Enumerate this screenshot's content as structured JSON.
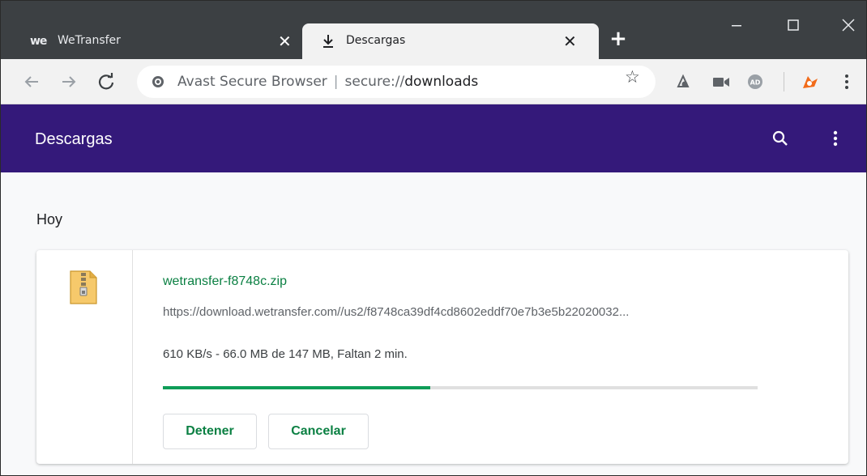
{
  "browser": {
    "tabs": [
      {
        "logo": "we",
        "label": "WeTransfer",
        "active": false
      },
      {
        "label": "Descargas",
        "active": true
      }
    ],
    "new_tab_label": "+",
    "close_glyph": "✕",
    "omnibox": {
      "site_label": "Avast Secure Browser",
      "separator": "|",
      "url_base": "secure://",
      "url_path": "downloads"
    },
    "extensions": [
      "avast-passwords-icon",
      "video-icon",
      "ad-block-icon",
      "avast-icon"
    ]
  },
  "app": {
    "title": "Descargas",
    "accent_color": "#34197a",
    "link_color": "#0b8043"
  },
  "downloads": {
    "section_label": "Hoy",
    "items": [
      {
        "file_name": "wetransfer-f8748c.zip",
        "url": "https://download.wetransfer.com//us2/f8748ca39df4cd8602eddf70e7b3e5b22020032...",
        "status": "610 KB/s - 66.0 MB de 147 MB, Faltan 2 min.",
        "progress_fraction": 0.449,
        "icon": "zip-file-icon",
        "actions": {
          "stop_label": "Detener",
          "cancel_label": "Cancelar"
        }
      }
    ]
  }
}
